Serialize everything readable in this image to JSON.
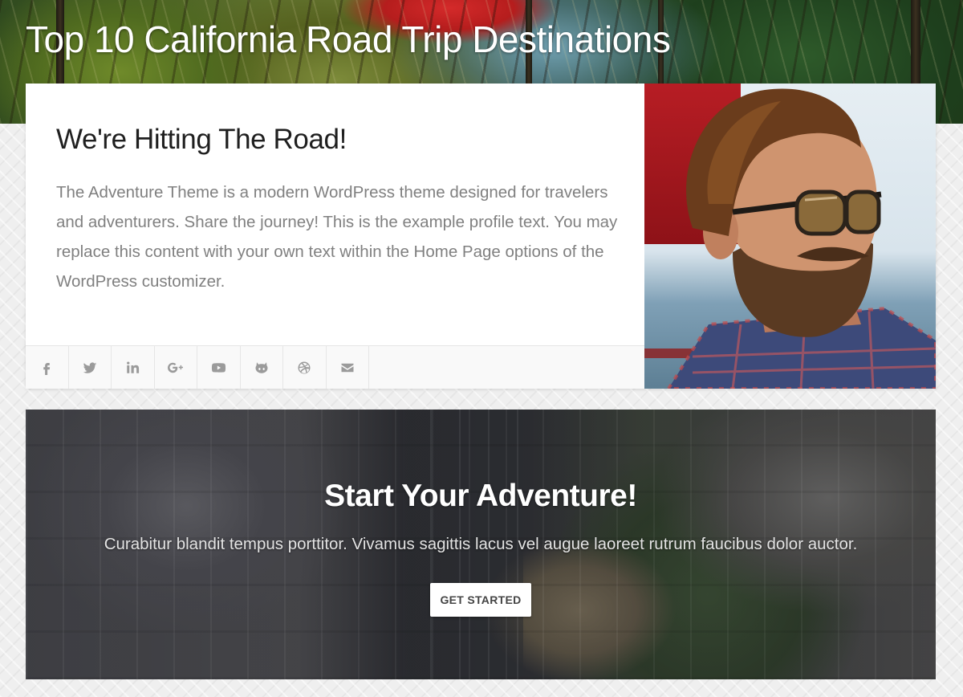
{
  "hero": {
    "title": "Top 10 California Road Trip Destinations"
  },
  "profile": {
    "heading": "We're Hitting The Road!",
    "body": "The Adventure Theme is a modern WordPress theme designed for travelers and adventurers. Share the journey! This is the example profile text. You may replace this content with your own text within the Home Page options of the WordPress customizer.",
    "social": [
      {
        "icon": "facebook-icon",
        "label": "f"
      },
      {
        "icon": "twitter-icon",
        "label": ""
      },
      {
        "icon": "linkedin-icon",
        "label": "in"
      },
      {
        "icon": "google-plus-icon",
        "label": "G+"
      },
      {
        "icon": "youtube-icon",
        "label": ""
      },
      {
        "icon": "github-icon",
        "label": ""
      },
      {
        "icon": "dribbble-icon",
        "label": ""
      },
      {
        "icon": "email-icon",
        "label": ""
      }
    ]
  },
  "cta": {
    "title": "Start Your Adventure!",
    "text": "Curabitur blandit tempus porttitor. Vivamus sagittis lacus vel augue laoreet rutrum faucibus dolor auctor.",
    "button_label": "GET STARTED"
  },
  "colors": {
    "background": "#efefef",
    "card": "#ffffff",
    "heading": "#1f1f1f",
    "body_text": "#808080",
    "icon": "#9b9b9b"
  }
}
